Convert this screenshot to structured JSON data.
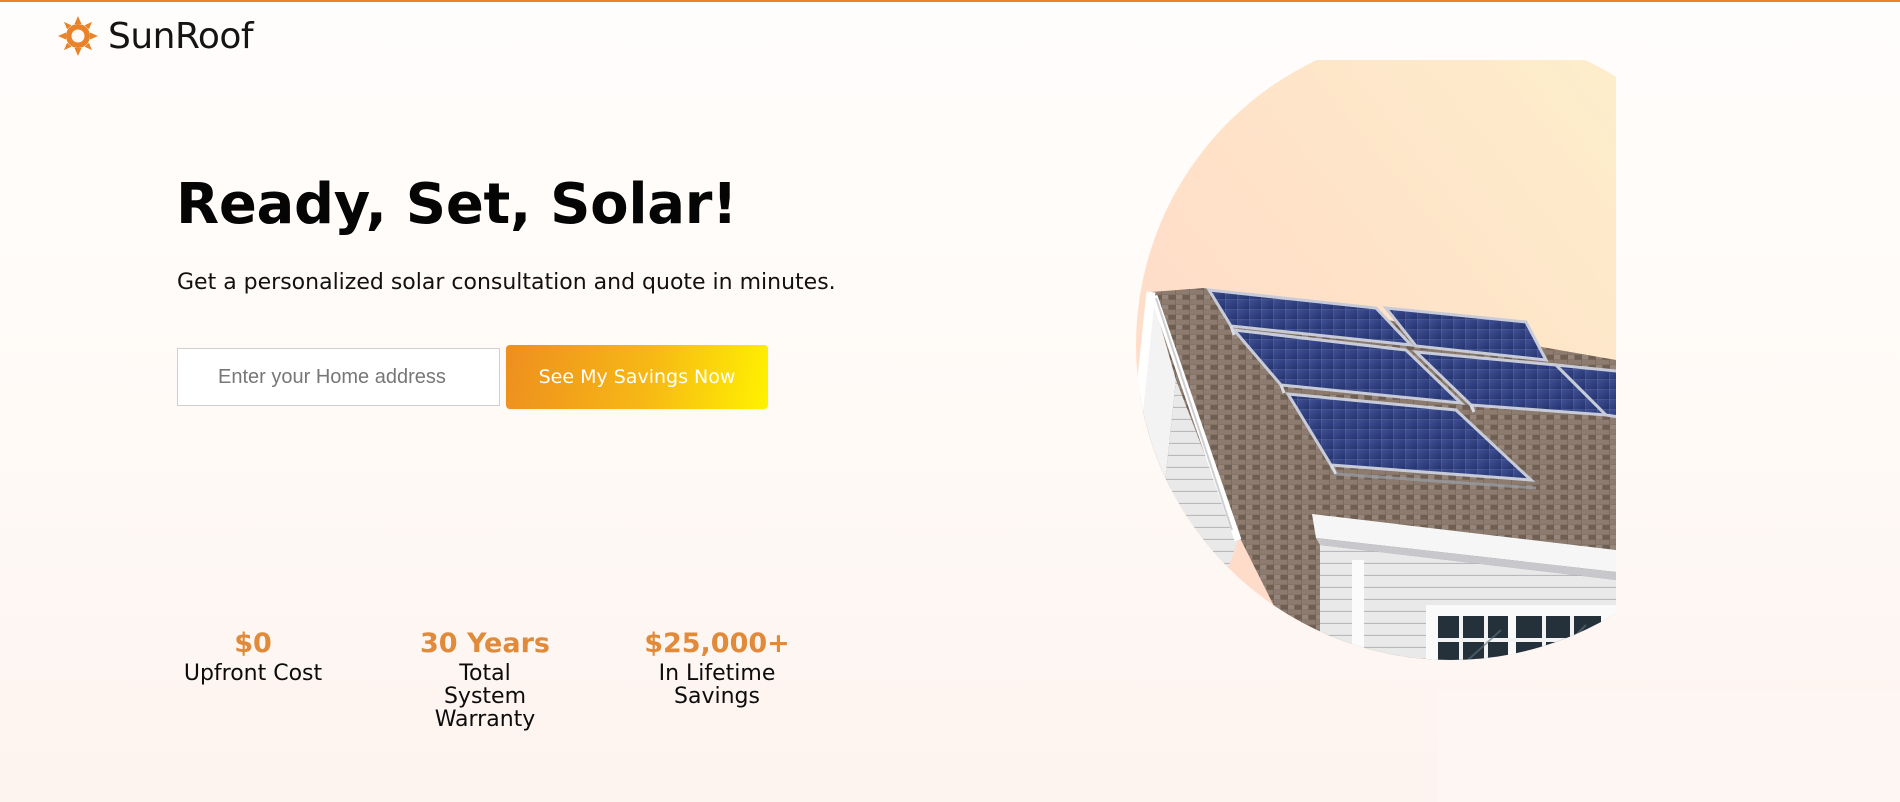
{
  "brand": {
    "name": "SunRoof",
    "logo_icon": "sun-icon",
    "accent_color": "#e8832a"
  },
  "hero": {
    "title": "Ready, Set, Solar!",
    "subtitle": "Get a personalized solar consultation and quote in minutes.",
    "address_placeholder": "Enter your Home address",
    "address_value": "",
    "cta_label": "See My Savings Now"
  },
  "stats": [
    {
      "value": "$0",
      "label": "Upfront Cost"
    },
    {
      "value": "30 Years",
      "label": "Total System Warranty"
    },
    {
      "value": "$25,000+",
      "label": "In Lifetime Savings"
    }
  ],
  "visual": {
    "image_subject": "house-roof-with-solar-panels"
  }
}
